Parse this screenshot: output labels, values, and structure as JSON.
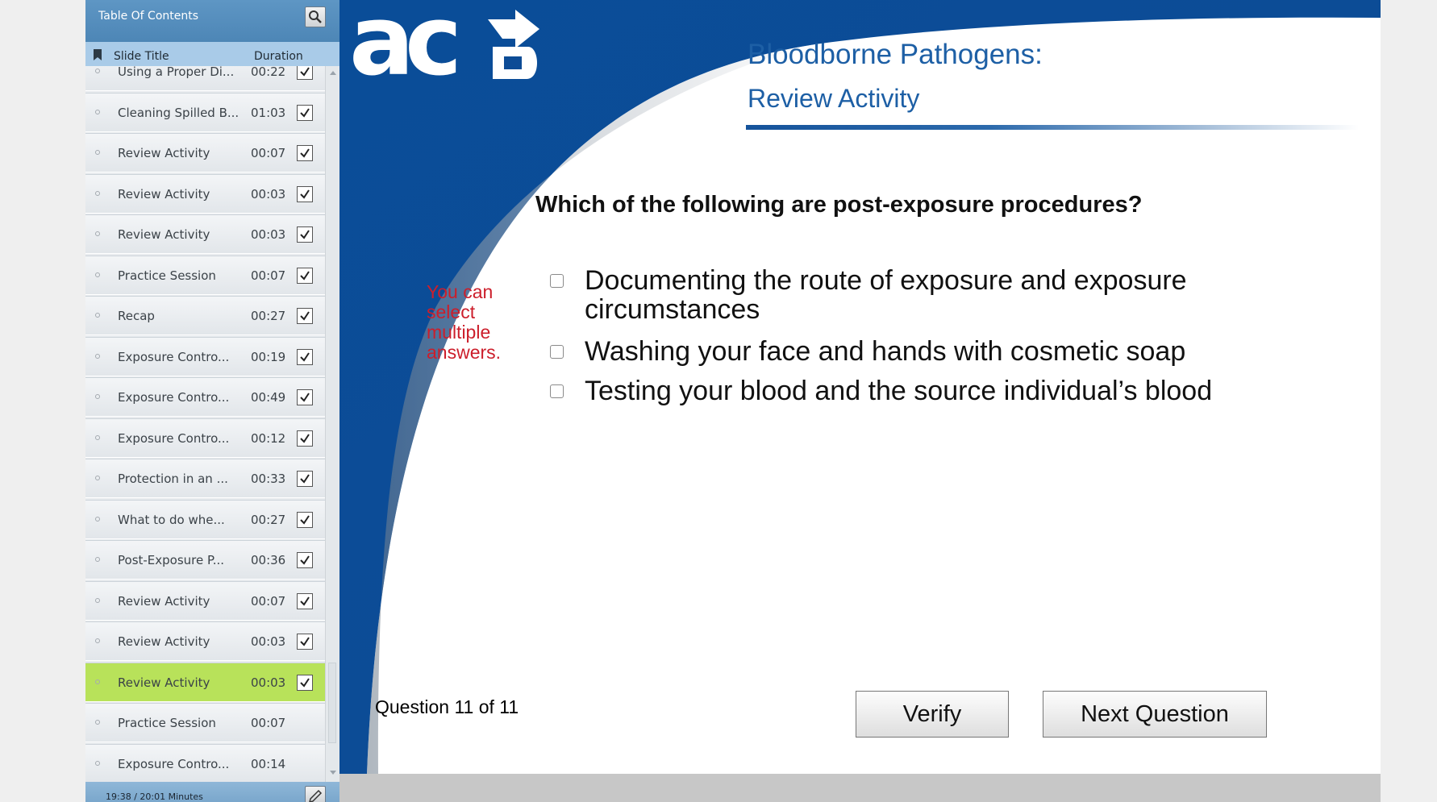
{
  "toc": {
    "title": "Table Of Contents",
    "columns": {
      "title": "Slide Title",
      "duration": "Duration"
    },
    "rows": [
      {
        "title": "Using a Proper Di...",
        "duration": "00:22",
        "checked": true,
        "current": false
      },
      {
        "title": "Cleaning Spilled B...",
        "duration": "01:03",
        "checked": true,
        "current": false
      },
      {
        "title": "Review Activity",
        "duration": "00:07",
        "checked": true,
        "current": false
      },
      {
        "title": "Review Activity",
        "duration": "00:03",
        "checked": true,
        "current": false
      },
      {
        "title": "Review Activity",
        "duration": "00:03",
        "checked": true,
        "current": false
      },
      {
        "title": "Practice Session",
        "duration": "00:07",
        "checked": true,
        "current": false
      },
      {
        "title": "Recap",
        "duration": "00:27",
        "checked": true,
        "current": false
      },
      {
        "title": "Exposure Contro...",
        "duration": "00:19",
        "checked": true,
        "current": false
      },
      {
        "title": "Exposure Contro...",
        "duration": "00:49",
        "checked": true,
        "current": false
      },
      {
        "title": "Exposure Contro...",
        "duration": "00:12",
        "checked": true,
        "current": false
      },
      {
        "title": "Protection in an ...",
        "duration": "00:33",
        "checked": true,
        "current": false
      },
      {
        "title": "What to do whe...",
        "duration": "00:27",
        "checked": true,
        "current": false
      },
      {
        "title": "Post-Exposure P...",
        "duration": "00:36",
        "checked": true,
        "current": false
      },
      {
        "title": "Review Activity",
        "duration": "00:07",
        "checked": true,
        "current": false
      },
      {
        "title": "Review Activity",
        "duration": "00:03",
        "checked": true,
        "current": false
      },
      {
        "title": "Review Activity",
        "duration": "00:03",
        "checked": true,
        "current": true
      },
      {
        "title": "Practice Session",
        "duration": "00:07",
        "checked": false,
        "current": false
      },
      {
        "title": "Exposure Contro...",
        "duration": "00:14",
        "checked": false,
        "current": false
      }
    ],
    "footer_time": "19:38 / 20:01 Minutes"
  },
  "slide": {
    "logo_alt": "ace logo",
    "title": "Bloodborne Pathogens:",
    "subtitle": "Review Activity",
    "question": "Which of the following are post-exposure procedures?",
    "hint": "You can select multiple answers.",
    "answers": [
      {
        "text": "Documenting the route of exposure and exposure circumstances",
        "checked": false
      },
      {
        "text": "Washing your face and hands with cosmetic soap",
        "checked": false
      },
      {
        "text": "Testing your blood and the source individual’s blood",
        "checked": false
      }
    ],
    "question_counter": "Question 11 of 11",
    "verify_label": "Verify",
    "next_label": "Next Question"
  },
  "colors": {
    "slide_blue": "#0d4c96",
    "title_blue": "#1d5fa5",
    "hint_red": "#cc1e2b",
    "current_row": "#b8e25a",
    "toc_header": "#5e96c4"
  }
}
